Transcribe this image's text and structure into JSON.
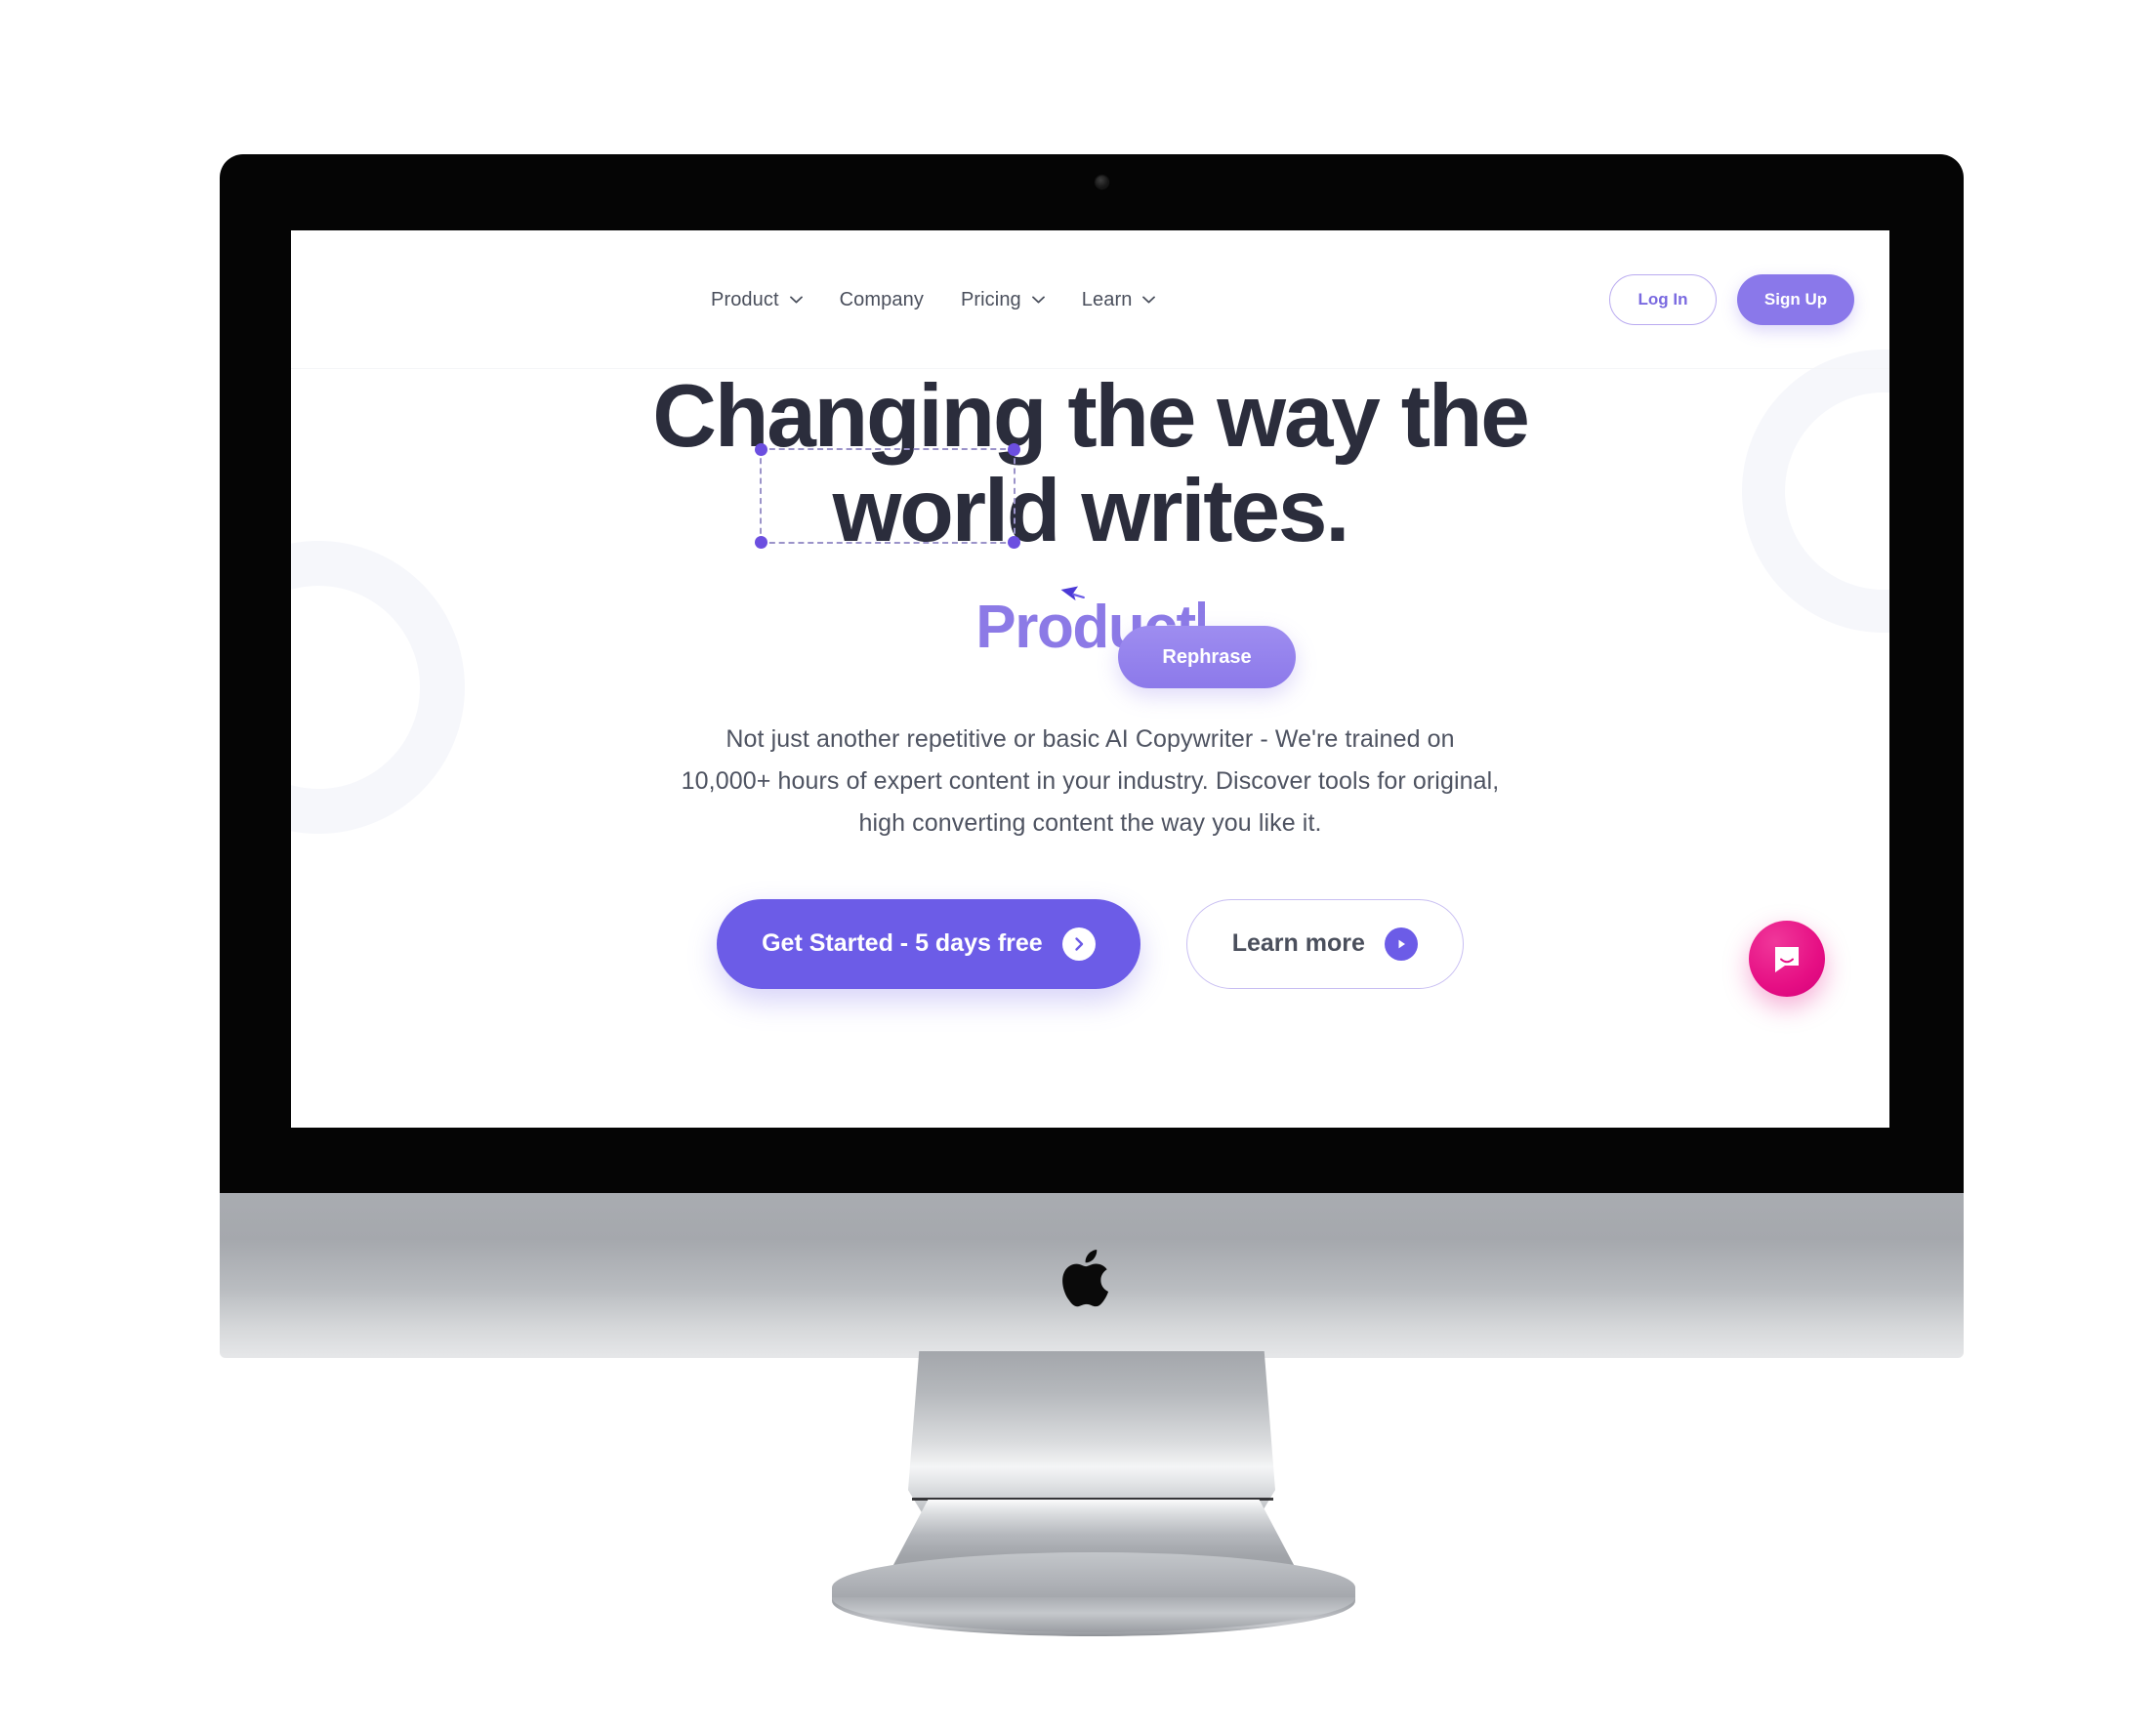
{
  "device": {
    "brand_logo": "apple-logo",
    "webcam": "webcam-dot"
  },
  "nav": {
    "items": [
      {
        "label": "Product",
        "has_dropdown": true
      },
      {
        "label": "Company",
        "has_dropdown": false
      },
      {
        "label": "Pricing",
        "has_dropdown": true
      },
      {
        "label": "Learn",
        "has_dropdown": true
      }
    ],
    "login_label": "Log In",
    "signup_label": "Sign Up"
  },
  "hero": {
    "headline_line1": "Changing the way the",
    "headline_line2_prefix": "world ",
    "headline_line2_selected": "writes.",
    "rephrase_label": "Rephrase",
    "typing_word": "Product",
    "lede": "Not just another repetitive or basic AI Copywriter - We're trained on 10,000+ hours of expert content in your industry. Discover tools for original, high converting content the way you like it.",
    "primary_cta": "Get Started - 5 days free",
    "secondary_cta": "Learn more"
  },
  "chat": {
    "label": "chat-launcher"
  },
  "colors": {
    "accent_purple": "#6c5ce7",
    "accent_purple_light": "#8c7ae6",
    "headline": "#2b2d3c",
    "body_text": "#4e5361",
    "chat_pink": "#e60f84",
    "selection_handle": "#6c4fe0"
  }
}
